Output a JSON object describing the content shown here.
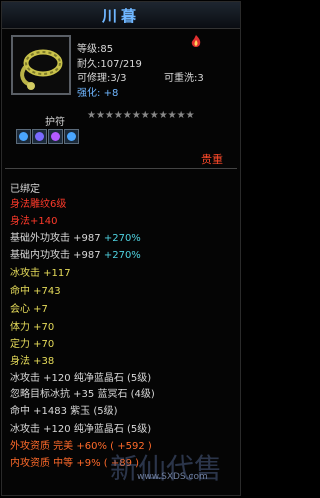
{
  "item": {
    "name": "川暮",
    "level": "等级:85",
    "durability": "耐久:107/219",
    "repairable": "可修理:3/3",
    "reset": "可重洗:3",
    "enhance_label": "强化:",
    "enhance_value": "+8",
    "charm_label": "护符",
    "stars_text": "★★★★★★★★★★★★",
    "value_label": "贵重",
    "icon": "jade-rope-ring-icon"
  },
  "properties": [
    {
      "text": "已绑定",
      "color": "white"
    },
    {
      "text": "身法雕纹6级",
      "color": "red"
    },
    {
      "text": "身法+140",
      "color": "red"
    },
    {
      "text": "基础外功攻击 +987",
      "extra": "+270%",
      "color": "white"
    },
    {
      "text": "基础内功攻击 +987",
      "extra": "+270%",
      "color": "white"
    },
    {
      "text": "冰攻击 +117",
      "color": "yellow"
    },
    {
      "text": "命中 +743",
      "color": "yellow"
    },
    {
      "text": "会心 +7",
      "color": "yellow"
    },
    {
      "text": "体力 +70",
      "color": "yellow"
    },
    {
      "text": "定力 +70",
      "color": "yellow"
    },
    {
      "text": "身法 +38",
      "color": "yellow"
    },
    {
      "text": "冰攻击 +120 纯净蓝晶石 (5级)",
      "color": "white"
    },
    {
      "text": "忽略目标冰抗 +35 蓝冥石 (4级)",
      "color": "white"
    },
    {
      "text": "命中 +1483 紫玉 (5级)",
      "color": "white"
    },
    {
      "text": "冰攻击 +120 纯净蓝晶石 (5级)",
      "color": "white"
    },
    {
      "text": "外攻资质  完美 +60% ( +592 )",
      "color": "orange"
    },
    {
      "text": "内攻资质  中等 +9% ( +89 )",
      "color": "orange"
    }
  ],
  "watermark": {
    "text": "新仙代售",
    "url_text": "www.SXDS.com"
  }
}
